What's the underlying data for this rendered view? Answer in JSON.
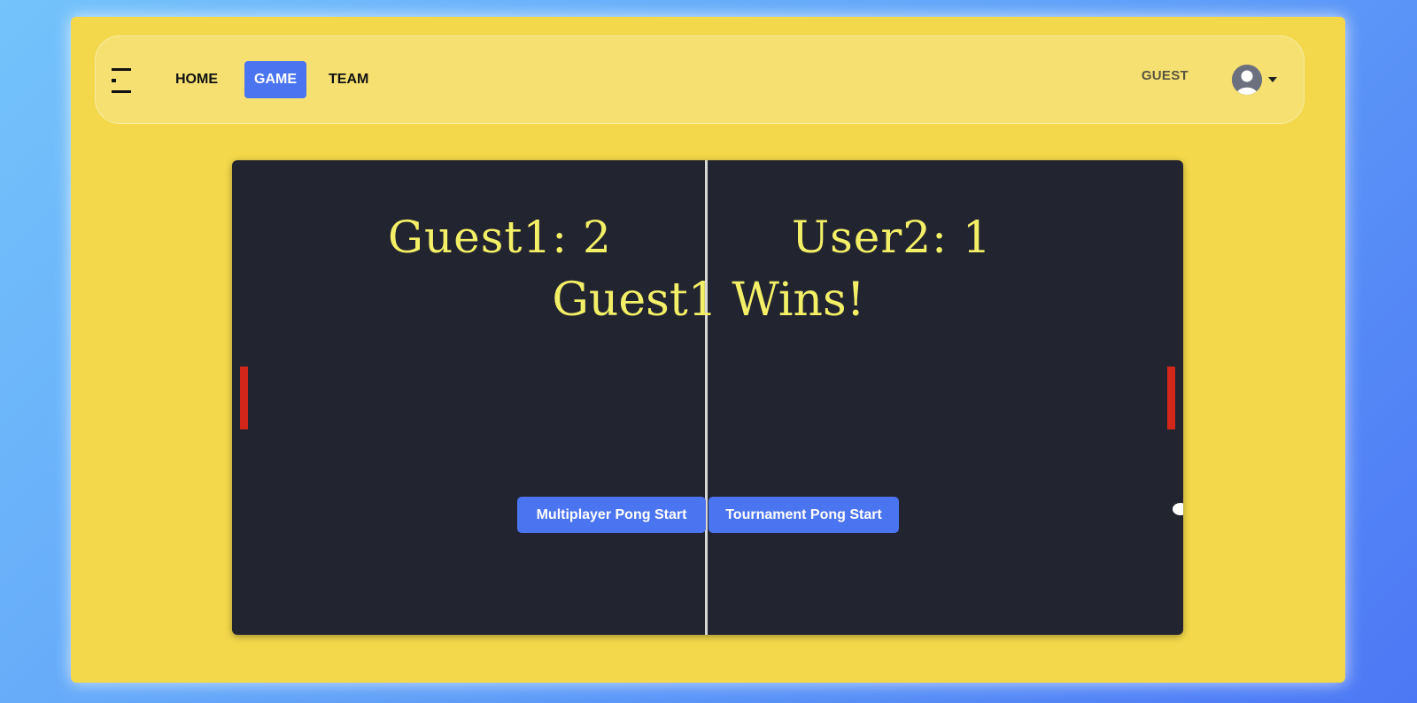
{
  "nav": {
    "links": [
      {
        "label": "HOME",
        "active": false
      },
      {
        "label": "GAME",
        "active": true
      },
      {
        "label": "TEAM",
        "active": false
      }
    ],
    "user_label": "GUEST"
  },
  "game": {
    "left_score_text": "Guest1: 2",
    "right_score_text": "User2: 1",
    "winner_text": "Guest1 Wins!",
    "buttons": {
      "multiplayer": "Multiplayer Pong Start",
      "tournament": "Tournament Pong Start"
    }
  },
  "colors": {
    "page_bg": "#f2d84a",
    "accent": "#4b74f0",
    "board": "#22242f",
    "score_text": "#f3f067",
    "paddle": "#d3261b",
    "ball": "#ffffff"
  }
}
